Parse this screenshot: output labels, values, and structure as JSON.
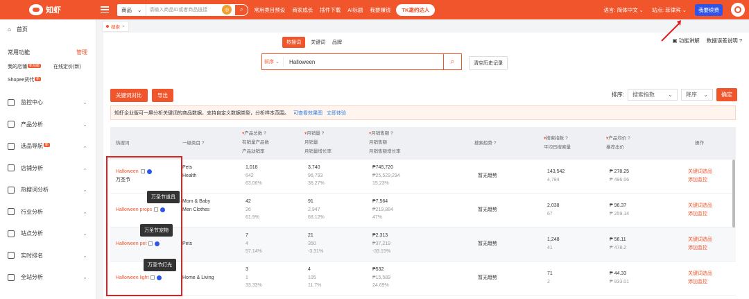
{
  "topbar": {
    "logo_text": "知虾",
    "search_category": "商品",
    "search_placeholder": "请输入商品ID或者商品链接",
    "nav": [
      "常用类目预设",
      "商家成长",
      "插件下载",
      "AI标题",
      "我要赚钱"
    ],
    "tk_button": "TK邀约达人",
    "language": "语言: 简体中文",
    "site": "站点: 菲律宾",
    "renew": "我要续费"
  },
  "sidebar": {
    "home": "首页",
    "common_title": "常用功能",
    "manage": "管理",
    "quick1": "我的店铺",
    "quick1_tag": "新功能",
    "quick2": "在线定价(新)",
    "quick3": "Shopee货代",
    "quick3_tag": "新",
    "items": [
      {
        "label": "监控中心"
      },
      {
        "label": "产品分析"
      },
      {
        "label": "选品导航",
        "tag": "新"
      },
      {
        "label": "店铺分析"
      },
      {
        "label": "热搜词分析"
      },
      {
        "label": "行业分析"
      },
      {
        "label": "站点分析"
      },
      {
        "label": "实时排名"
      },
      {
        "label": "全站分析"
      }
    ]
  },
  "page_tab": "搜索",
  "subtabs": {
    "hot": "热搜词",
    "kw": "关键词",
    "tag": "品牌"
  },
  "help": {
    "explain": "功能讲解",
    "data_note": "数据误差说明"
  },
  "search": {
    "sort": "前序",
    "value": "Halloween",
    "clear": "清空历史记录"
  },
  "buttons": {
    "compare": "关键词对比",
    "export": "导出"
  },
  "sortbar": {
    "label": "排序:",
    "field": "搜索指数",
    "order": "降序",
    "confirm": "确定"
  },
  "notice": {
    "text": "知虾企业版可一屏分析关键词的商品数据，支持自定义数据类型，分析样本范围。",
    "link1": "可查看效果图",
    "link2": "立即体验"
  },
  "headers": {
    "kw": "热搜词",
    "cat": "一级类目",
    "prod_total": "产品总数",
    "prod_sold": "有销量产品数",
    "prod_rate": "产品动销率",
    "monthly": "月销量",
    "monthly2": "月销量",
    "monthly_growth": "月销量增长率",
    "rev": "月销售额",
    "rev2": "月销售额",
    "rev_growth": "月销售额增长率",
    "trend": "搜索趋势",
    "search_idx": "搜索指数",
    "daily_search": "平均日搜索量",
    "avg_price": "产品均价",
    "rec_price": "推荐出价",
    "op": "操作"
  },
  "rows": [
    {
      "kw": "Halloween",
      "kw_cn": "万圣节",
      "cat": [
        "Pets",
        "Health"
      ],
      "prod": [
        "1,018",
        "642",
        "63.06%"
      ],
      "sales": [
        "3,740",
        "96,793",
        "38.27%"
      ],
      "rev": [
        "₱745,720",
        "₱25,529,294",
        "15.23%"
      ],
      "trend": "暂无趋势",
      "idx": [
        "143,542",
        "4,784"
      ],
      "price": [
        "₱ 278.25",
        "₱ 496.06"
      ]
    },
    {
      "kw": "Halloween props",
      "kw_cn": "",
      "cat": [
        "Mom & Baby",
        "Men Clothes"
      ],
      "prod": [
        "42",
        "26",
        "61.9%"
      ],
      "sales": [
        "91",
        "2,947",
        "68.12%"
      ],
      "rev": [
        "₱7,564",
        "₱219,884",
        "47%"
      ],
      "trend": "暂无趋势",
      "idx": [
        "2,038",
        "67"
      ],
      "price": [
        "₱ 96.37",
        "₱ 259.14"
      ]
    },
    {
      "kw": "Halloween pet",
      "kw_cn": "",
      "cat": [
        "Pets",
        ""
      ],
      "prod": [
        "7",
        "4",
        "57.14%"
      ],
      "sales": [
        "21",
        "350",
        "-3.31%"
      ],
      "rev": [
        "₱2,313",
        "₱37,219",
        "-33.15%"
      ],
      "trend": "暂无趋势",
      "idx": [
        "1,248",
        "41"
      ],
      "price": [
        "₱ 56.11",
        "₱ 478.2"
      ]
    },
    {
      "kw": "Halloween light",
      "kw_cn": "",
      "cat": [
        "Home & Living",
        ""
      ],
      "prod": [
        "3",
        "1",
        "33.33%"
      ],
      "sales": [
        "4",
        "105",
        "11.7%"
      ],
      "rev": [
        "₱532",
        "₱15,589",
        "24.69%"
      ],
      "trend": "暂无趋势",
      "idx": [
        "71",
        "2"
      ],
      "price": [
        "₱ 44.33",
        "₱ 933.01"
      ]
    }
  ],
  "actions": {
    "select": "关键词选品",
    "monitor": "添加监控"
  },
  "tooltips": [
    "万圣节道具",
    "万圣节宠物",
    "万圣节灯光"
  ],
  "colors": {
    "brand": "#f0552c",
    "blue": "#2f54eb"
  }
}
